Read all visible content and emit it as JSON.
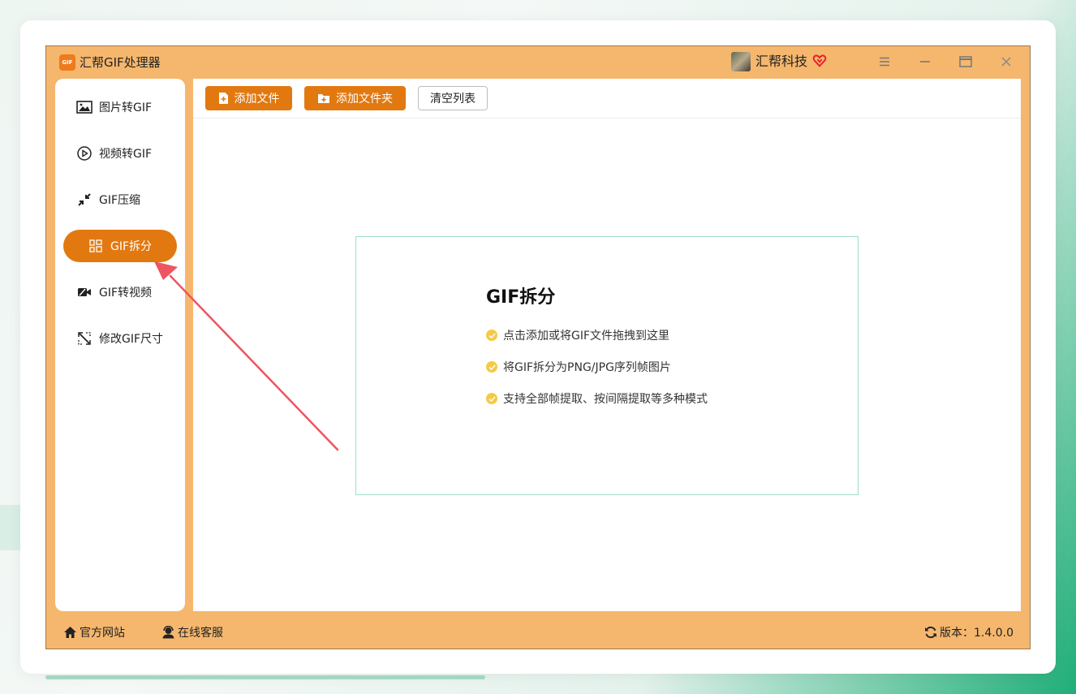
{
  "app": {
    "title": "汇帮GIF处理器",
    "logo_text": "GIF",
    "user_name": "汇帮科技"
  },
  "sidebar": {
    "items": [
      {
        "label": "图片转GIF",
        "icon": "image-icon",
        "active": false
      },
      {
        "label": "视频转GIF",
        "icon": "video-play-icon",
        "active": false
      },
      {
        "label": "GIF压缩",
        "icon": "compress-icon",
        "active": false
      },
      {
        "label": "GIF拆分",
        "icon": "split-grid-icon",
        "active": true
      },
      {
        "label": "GIF转视频",
        "icon": "video-camera-icon",
        "active": false
      },
      {
        "label": "修改GIF尺寸",
        "icon": "resize-icon",
        "active": false
      }
    ]
  },
  "toolbar": {
    "add_file": "添加文件",
    "add_folder": "添加文件夹",
    "clear_list": "清空列表"
  },
  "drop_zone": {
    "title": "GIF拆分",
    "features": [
      "点击添加或将GIF文件拖拽到这里",
      "将GIF拆分为PNG/JPG序列帧图片",
      "支持全部帧提取、按间隔提取等多种模式"
    ]
  },
  "footer": {
    "website": "官方网站",
    "support": "在线客服",
    "version": "版本：1.4.0.0"
  },
  "colors": {
    "accent": "#e27910",
    "frame": "#f5b76d",
    "check": "#f6c945",
    "annotation_arrow": "#ee5560"
  }
}
